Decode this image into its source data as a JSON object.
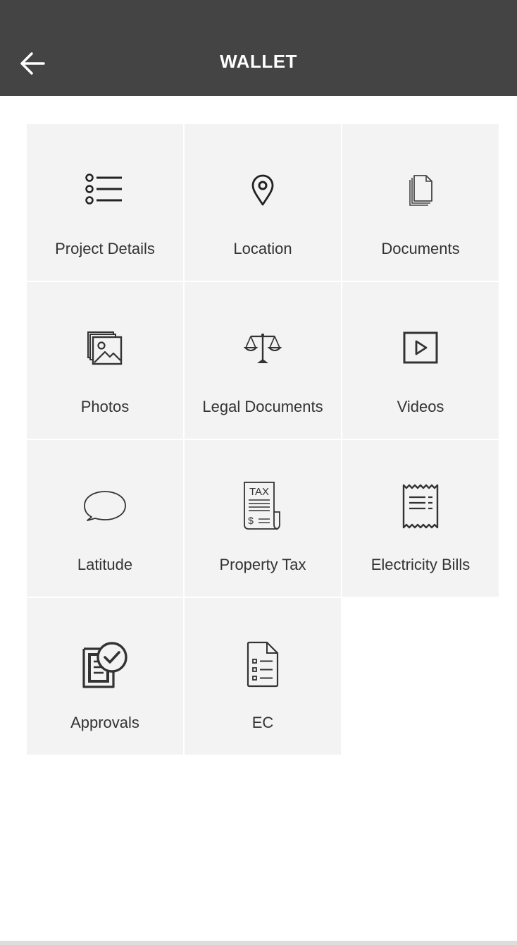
{
  "header": {
    "title": "WALLET",
    "back_icon": "arrow-left-icon",
    "background": "#444444"
  },
  "tiles": [
    {
      "label": "Project Details",
      "icon": "list-icon"
    },
    {
      "label": "Location",
      "icon": "map-pin-icon"
    },
    {
      "label": "Documents",
      "icon": "documents-stack-icon"
    },
    {
      "label": "Photos",
      "icon": "photos-stack-icon"
    },
    {
      "label": "Legal Documents",
      "icon": "scales-icon"
    },
    {
      "label": "Videos",
      "icon": "video-play-icon"
    },
    {
      "label": "Latitude",
      "icon": "speech-bubble-icon"
    },
    {
      "label": "Property Tax",
      "icon": "tax-receipt-icon"
    },
    {
      "label": "Electricity Bills",
      "icon": "bill-receipt-icon"
    },
    {
      "label": "Approvals",
      "icon": "approval-check-icon"
    },
    {
      "label": "EC",
      "icon": "checklist-document-icon"
    }
  ],
  "icon_texts": {
    "tax": "TAX",
    "dollar": "$"
  },
  "colors": {
    "tile_background": "#f3f3f3",
    "icon_stroke": "#333333"
  }
}
